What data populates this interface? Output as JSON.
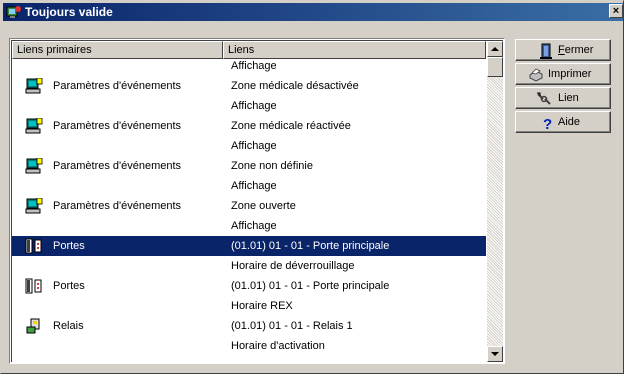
{
  "window": {
    "title": "Toujours valide",
    "close_glyph": "×"
  },
  "list": {
    "columns": [
      "Liens primaires",
      "Liens"
    ],
    "rows": [
      {
        "primary": "",
        "link": "Affichage",
        "icon": "",
        "kind": "sub"
      },
      {
        "primary": "Paramètres d'événements",
        "link": "Zone médicale désactivée",
        "icon": "computer-icon",
        "kind": "main"
      },
      {
        "primary": "",
        "link": "Affichage",
        "icon": "",
        "kind": "sub"
      },
      {
        "primary": "Paramètres d'événements",
        "link": "Zone médicale réactivée",
        "icon": "computer-icon",
        "kind": "main"
      },
      {
        "primary": "",
        "link": "Affichage",
        "icon": "",
        "kind": "sub"
      },
      {
        "primary": "Paramètres d'événements",
        "link": "Zone non définie",
        "icon": "computer-icon",
        "kind": "main"
      },
      {
        "primary": "",
        "link": "Affichage",
        "icon": "",
        "kind": "sub"
      },
      {
        "primary": "Paramètres d'événements",
        "link": "Zone ouverte",
        "icon": "computer-icon",
        "kind": "main"
      },
      {
        "primary": "",
        "link": "Affichage",
        "icon": "",
        "kind": "sub"
      },
      {
        "primary": "Portes",
        "link": "(01.01) 01 - 01 - Porte principale",
        "icon": "door-icon",
        "kind": "main",
        "selected": true
      },
      {
        "primary": "",
        "link": "Horaire de déverrouillage",
        "icon": "",
        "kind": "sub"
      },
      {
        "primary": "Portes",
        "link": "(01.01) 01 - 01 - Porte principale",
        "icon": "door-icon",
        "kind": "main"
      },
      {
        "primary": "",
        "link": "Horaire REX",
        "icon": "",
        "kind": "sub"
      },
      {
        "primary": "Relais",
        "link": "(01.01) 01 - 01 - Relais 1",
        "icon": "relay-icon",
        "kind": "main"
      },
      {
        "primary": "",
        "link": "Horaire d'activation",
        "icon": "",
        "kind": "sub"
      }
    ]
  },
  "buttons": {
    "fermer": {
      "prefix": "",
      "mnemonic": "F",
      "rest": "ermer",
      "icon": "door-close-icon"
    },
    "imprimer": {
      "label": "Imprimer",
      "icon": "printer-icon"
    },
    "lien": {
      "label": "Lien",
      "icon": "link-icon"
    },
    "aide": {
      "label": "Aide",
      "icon": "help-icon"
    }
  },
  "colors": {
    "title_start": "#0a246a",
    "title_end": "#3a6ea5",
    "selection": "#0a246a",
    "face": "#d4d0c8"
  }
}
